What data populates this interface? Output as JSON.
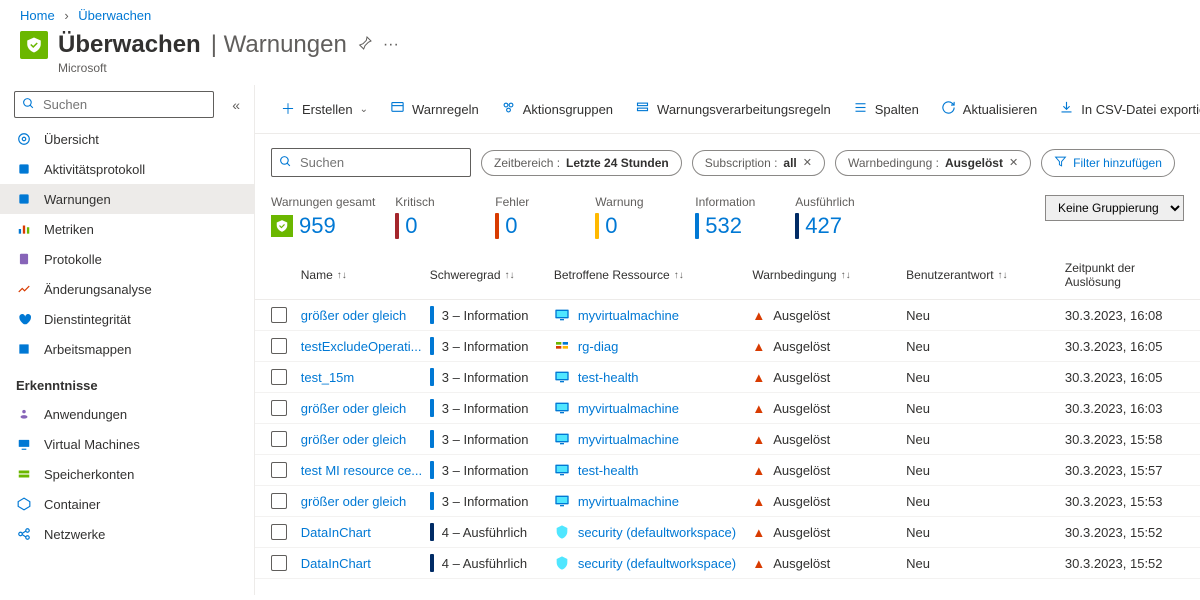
{
  "breadcrumb": {
    "home": "Home",
    "current": "Überwachen"
  },
  "header": {
    "title": "Überwachen",
    "section": "Warnungen",
    "subtitle": "Microsoft"
  },
  "sidebarSearch": {
    "placeholder": "Suchen"
  },
  "sidebar": {
    "items": [
      {
        "label": "Übersicht",
        "icon": "overview"
      },
      {
        "label": "Aktivitätsprotokoll",
        "icon": "activity"
      },
      {
        "label": "Warnungen",
        "icon": "alerts",
        "active": true
      },
      {
        "label": "Metriken",
        "icon": "metrics"
      },
      {
        "label": "Protokolle",
        "icon": "logs"
      },
      {
        "label": "Änderungsanalyse",
        "icon": "change"
      },
      {
        "label": "Dienstintegrität",
        "icon": "health"
      },
      {
        "label": "Arbeitsmappen",
        "icon": "workbooks"
      }
    ],
    "group1": "Erkenntnisse",
    "insights": [
      {
        "label": "Anwendungen",
        "icon": "apps"
      },
      {
        "label": "Virtual Machines",
        "icon": "vm"
      },
      {
        "label": "Speicherkonten",
        "icon": "storage"
      },
      {
        "label": "Container",
        "icon": "container"
      },
      {
        "label": "Netzwerke",
        "icon": "network"
      }
    ]
  },
  "toolbar": {
    "create": "Erstellen",
    "rules": "Warnregeln",
    "groups": "Aktionsgruppen",
    "processing": "Warnungsverarbeitungsregeln",
    "columns": "Spalten",
    "refresh": "Aktualisieren",
    "export": "In CSV-Datei exportieren"
  },
  "filters": {
    "searchPlaceholder": "Suchen",
    "timerange": {
      "key": "Zeitbereich : ",
      "val": "Letzte 24 Stunden"
    },
    "subscription": {
      "key": "Subscription : ",
      "val": "all"
    },
    "condition": {
      "key": "Warnbedingung : ",
      "val": "Ausgelöst"
    },
    "addFilter": "Filter hinzufügen"
  },
  "summary": {
    "total": {
      "label": "Warnungen gesamt",
      "value": "959"
    },
    "critical": {
      "label": "Kritisch",
      "value": "0",
      "color": "#a4262c"
    },
    "error": {
      "label": "Fehler",
      "value": "0",
      "color": "#d83b01"
    },
    "warning": {
      "label": "Warnung",
      "value": "0",
      "color": "#ffb900"
    },
    "info": {
      "label": "Information",
      "value": "532",
      "color": "#0078d4"
    },
    "verbose": {
      "label": "Ausführlich",
      "value": "427",
      "color": "#012b65"
    },
    "grouping": "Keine Gruppierung"
  },
  "columns": {
    "name": "Name",
    "severity": "Schweregrad",
    "resource": "Betroffene Ressource",
    "condition": "Warnbedingung",
    "userResponse": "Benutzerantwort",
    "time": "Zeitpunkt der Auslösung"
  },
  "rows": [
    {
      "name": "größer oder gleich",
      "sev": "3 – Information",
      "sevClass": "sev3",
      "res": "myvirtualmachine",
      "resType": "vm",
      "cond": "Ausgelöst",
      "user": "Neu",
      "time": "30.3.2023, 16:08"
    },
    {
      "name": "testExcludeOperati...",
      "sev": "3 – Information",
      "sevClass": "sev3",
      "res": "rg-diag",
      "resType": "rg",
      "cond": "Ausgelöst",
      "user": "Neu",
      "time": "30.3.2023, 16:05"
    },
    {
      "name": "test_15m",
      "sev": "3 – Information",
      "sevClass": "sev3",
      "res": "test-health",
      "resType": "vm",
      "cond": "Ausgelöst",
      "user": "Neu",
      "time": "30.3.2023, 16:05"
    },
    {
      "name": "größer oder gleich",
      "sev": "3 – Information",
      "sevClass": "sev3",
      "res": "myvirtualmachine",
      "resType": "vm",
      "cond": "Ausgelöst",
      "user": "Neu",
      "time": "30.3.2023, 16:03"
    },
    {
      "name": "größer oder gleich",
      "sev": "3 – Information",
      "sevClass": "sev3",
      "res": "myvirtualmachine",
      "resType": "vm",
      "cond": "Ausgelöst",
      "user": "Neu",
      "time": "30.3.2023, 15:58"
    },
    {
      "name": "test MI resource ce...",
      "sev": "3 – Information",
      "sevClass": "sev3",
      "res": "test-health",
      "resType": "vm",
      "cond": "Ausgelöst",
      "user": "Neu",
      "time": "30.3.2023, 15:57"
    },
    {
      "name": "größer oder gleich",
      "sev": "3 – Information",
      "sevClass": "sev3",
      "res": "myvirtualmachine",
      "resType": "vm",
      "cond": "Ausgelöst",
      "user": "Neu",
      "time": "30.3.2023, 15:53"
    },
    {
      "name": "DataInChart",
      "sev": "4 – Ausführlich",
      "sevClass": "sev4",
      "res": "security (defaultworkspace)",
      "resType": "sec",
      "cond": "Ausgelöst",
      "user": "Neu",
      "time": "30.3.2023, 15:52"
    },
    {
      "name": "DataInChart",
      "sev": "4 – Ausführlich",
      "sevClass": "sev4",
      "res": "security (defaultworkspace)",
      "resType": "sec",
      "cond": "Ausgelöst",
      "user": "Neu",
      "time": "30.3.2023, 15:52"
    }
  ]
}
